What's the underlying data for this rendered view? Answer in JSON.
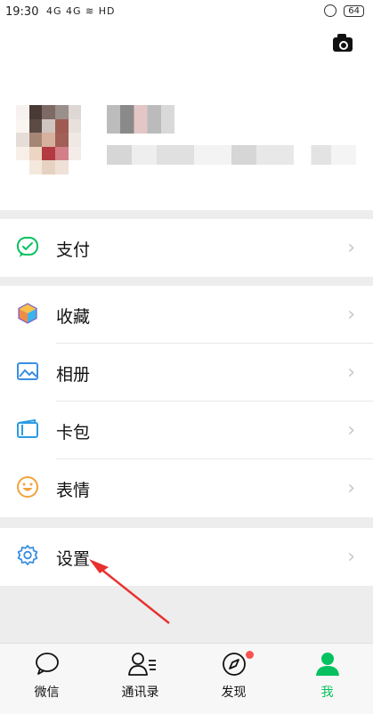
{
  "status_bar": {
    "time": "19:30",
    "signal": "4G 4G ≋ HD",
    "battery": "64"
  },
  "menu": {
    "pay": "支付",
    "favorites": "收藏",
    "album": "相册",
    "cards": "卡包",
    "stickers": "表情",
    "settings": "设置",
    "chevron": "›"
  },
  "tabs": {
    "chats": "微信",
    "contacts": "通讯录",
    "discover": "发现",
    "me": "我"
  },
  "colors": {
    "accent": "#07c160",
    "badge": "#fa5151",
    "arrow": "#e8312f"
  }
}
